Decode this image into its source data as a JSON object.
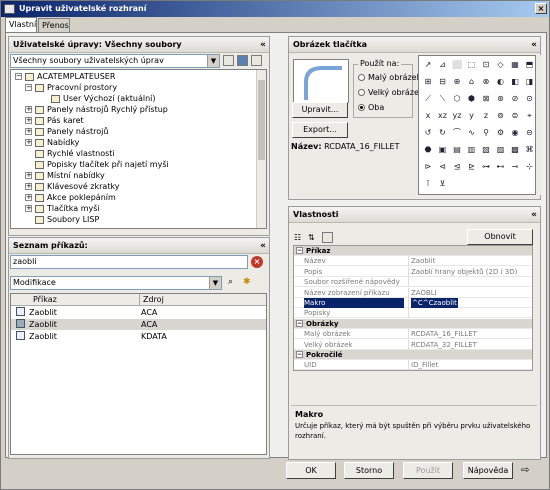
{
  "window": {
    "title": "Upravit uživatelské rozhraní",
    "close": "×"
  },
  "tabs": [
    {
      "label": "Vlastní"
    },
    {
      "label": "Přenos"
    }
  ],
  "customizations": {
    "title": "Uživatelské úpravy: Všechny soubory",
    "combo": "Všechny soubory uživatelských úprav",
    "tree": [
      {
        "label": "ACATEMPLATEUSER"
      },
      {
        "label": "Pracovní prostory"
      },
      {
        "label": "User Výchozí (aktuální)"
      },
      {
        "label": "Panely nástrojů Rychlý přístup"
      },
      {
        "label": "Pás karet"
      },
      {
        "label": "Panely nástrojů"
      },
      {
        "label": "Nabídky"
      },
      {
        "label": "Rychlé vlastnosti"
      },
      {
        "label": "Popisky tlačítek při najetí myši"
      },
      {
        "label": "Místní nabídky"
      },
      {
        "label": "Klávesové zkratky"
      },
      {
        "label": "Akce poklepáním"
      },
      {
        "label": "Tlačítka myši"
      },
      {
        "label": "Soubory LISP"
      }
    ]
  },
  "commands": {
    "title": "Seznam příkazů:",
    "search": "zaobli",
    "filter": "Modifikace",
    "columns": {
      "command": "Příkaz",
      "source": "Zdroj"
    },
    "rows": [
      {
        "command": "Zaoblit",
        "source": "ACA"
      },
      {
        "command": "Zaoblit",
        "source": "ACA"
      },
      {
        "command": "Zaoblit",
        "source": "KDATA"
      }
    ]
  },
  "button_image": {
    "title": "Obrázek tlačítka",
    "apply_to": "Použít na:",
    "radios": [
      {
        "label": "Malý obrázek",
        "checked": false
      },
      {
        "label": "Velký obrázek",
        "checked": false
      },
      {
        "label": "Oba",
        "checked": true
      }
    ],
    "edit": "Upravit...",
    "export": "Export...",
    "name_label": "Název:",
    "name_value": "RCDATA_16_FILLET"
  },
  "icon_grid": [
    "↗",
    "⊿",
    "⬜",
    "⬚",
    "⊡",
    "◇",
    "▦",
    "⬒",
    "⊞",
    "⊟",
    "⊕",
    "⌂",
    "⊗",
    "◐",
    "◧",
    "◨",
    "⟋",
    "⟍",
    "⬡",
    "⬢",
    "⊠",
    "⊛",
    "⊘",
    "⊙",
    "x",
    "xz",
    "yz",
    "y",
    "z",
    "⊚",
    "⊜",
    "⌖",
    "↺",
    "↻",
    "⌒",
    "∿",
    "⚲",
    "⚙",
    "◉",
    "⊝",
    "⬣",
    "▣",
    "▤",
    "▥",
    "▧",
    "▨",
    "▩",
    "⌘",
    "⊳",
    "⊲",
    "⊴",
    "⊵",
    "⊶",
    "⊷",
    "⊸",
    "⊹",
    "⊺",
    "⊻"
  ],
  "properties": {
    "title": "Vlastnosti",
    "reset": "Obnovit výchozí",
    "rows": [
      {
        "type": "cat",
        "label": "Příkaz"
      },
      {
        "label": "Název",
        "value": "Zaoblit"
      },
      {
        "label": "Popis",
        "value": "Zaoblí hrany objektů (2D i 3D)"
      },
      {
        "label": "Soubor rozšířené nápovědy",
        "value": ""
      },
      {
        "label": "Název zobrazení příkazu",
        "value": "ZAOBLI"
      },
      {
        "label": "Makro",
        "value": "^C^Czaoblit",
        "highlight": true
      },
      {
        "label": "Popisky",
        "value": ""
      },
      {
        "type": "cat",
        "label": "Obrázky"
      },
      {
        "label": "Malý obrázek",
        "value": "RCDATA_16_FILLET"
      },
      {
        "label": "Velký obrázek",
        "value": "RCDATA_32_FILLET"
      },
      {
        "type": "cat",
        "label": "Pokročilé"
      },
      {
        "label": "UID",
        "value": "ID_Fillet"
      }
    ],
    "desc_title": "Makro",
    "desc_text": "Určuje příkaz, který má být spuštěn při výběru prvku uživatelského rozhraní."
  },
  "footer": {
    "ok": "OK",
    "cancel": "Storno",
    "apply": "Použít",
    "help": "Nápověda"
  }
}
